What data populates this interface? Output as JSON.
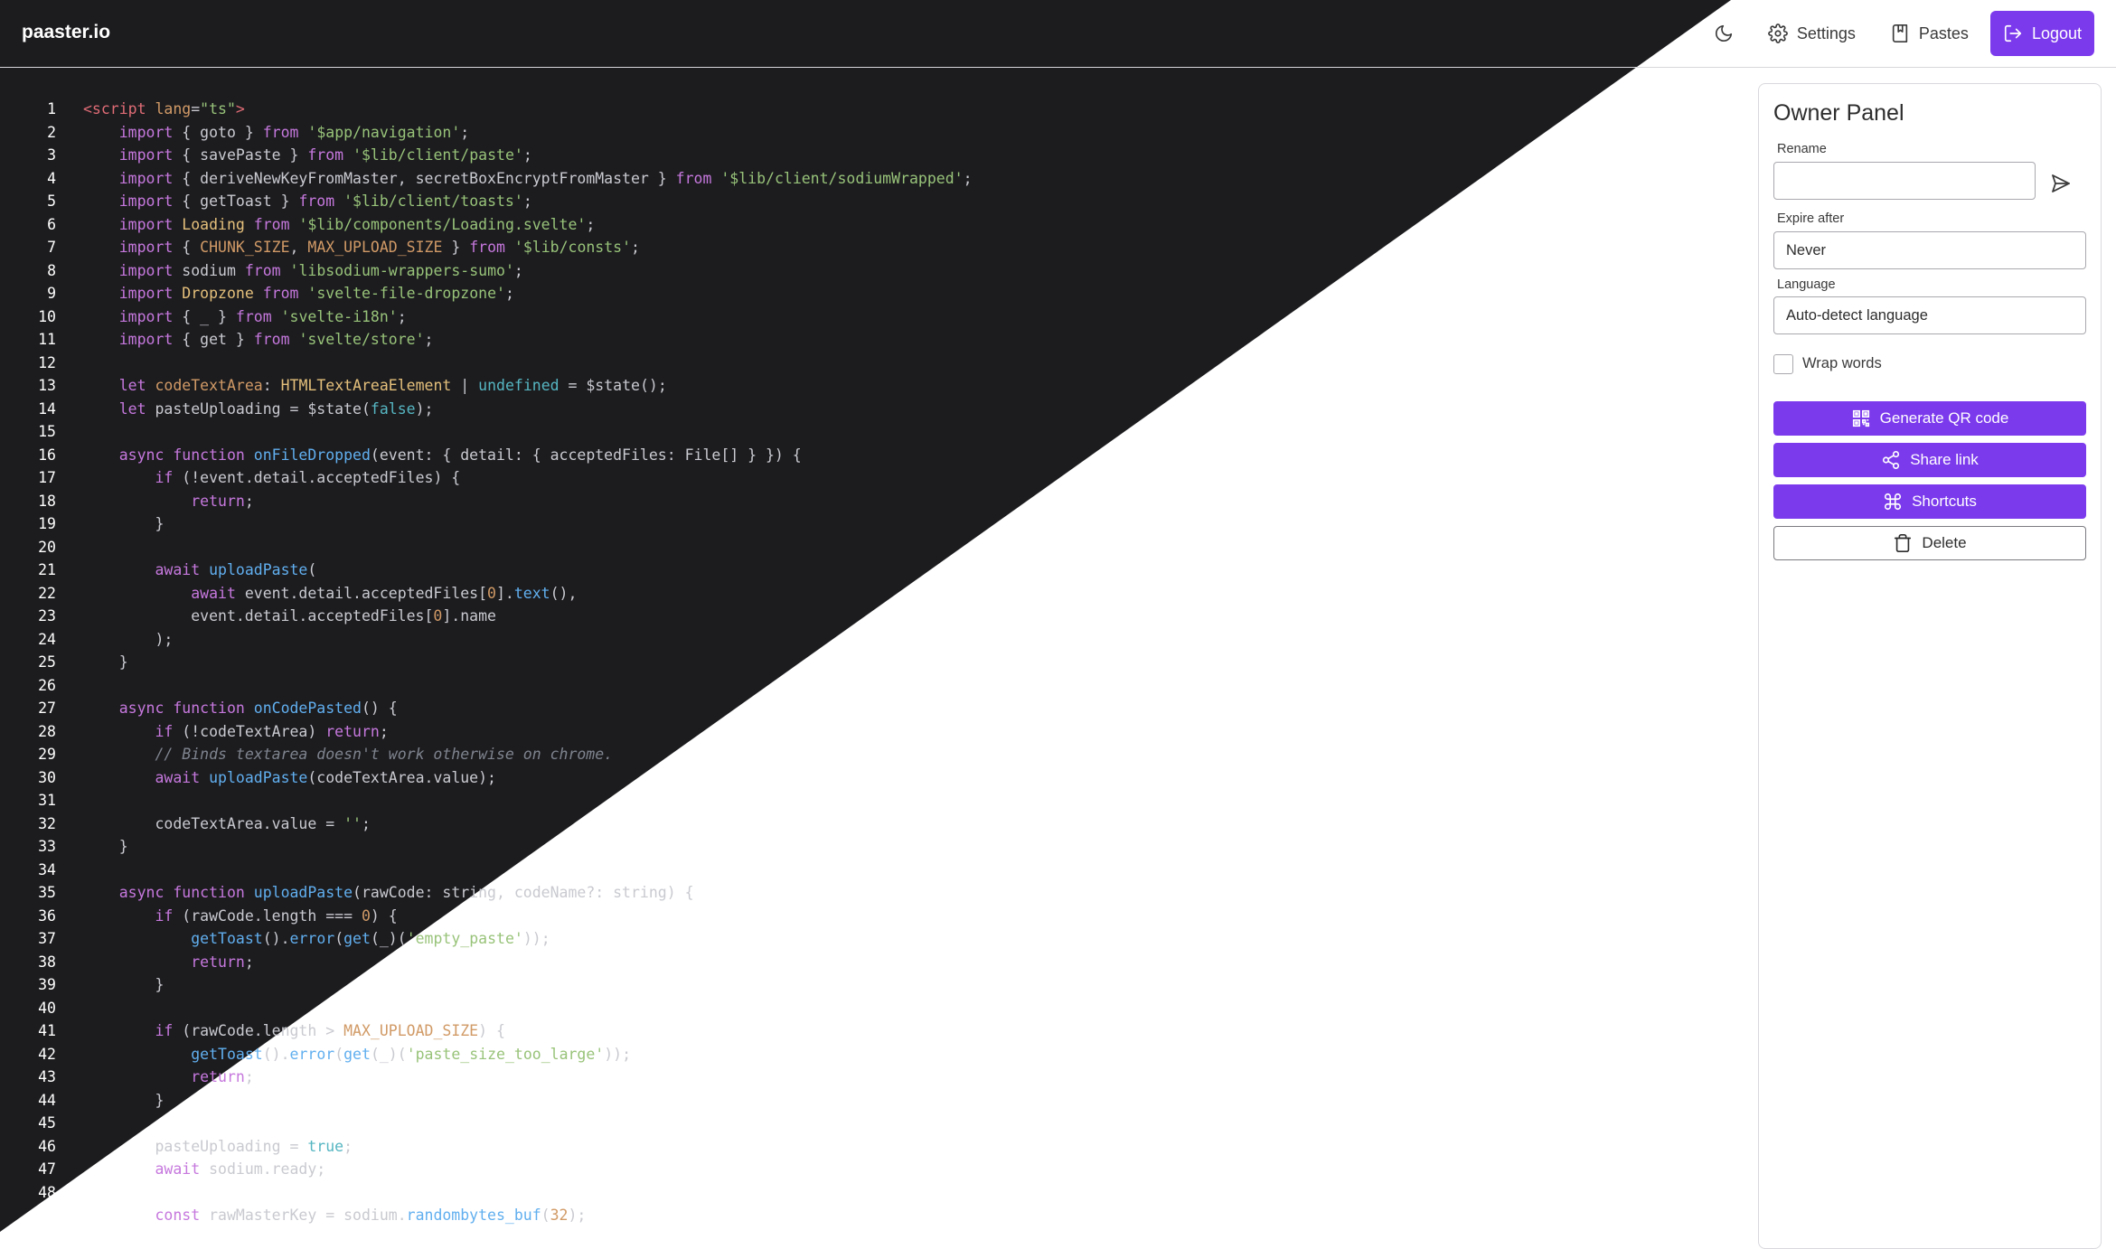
{
  "brand": "paaster.io",
  "nav": {
    "theme_icon": "moon-icon",
    "settings_label": "Settings",
    "pastes_label": "Pastes",
    "logout_label": "Logout"
  },
  "owner_panel": {
    "title": "Owner Panel",
    "rename_label": "Rename",
    "rename_value": "",
    "expire_label": "Expire after",
    "expire_value": "Never",
    "language_label": "Language",
    "language_value": "Auto-detect language",
    "wrap_label": "Wrap words",
    "wrap_checked": false,
    "qr_label": "Generate QR code",
    "share_label": "Share link",
    "shortcuts_label": "Shortcuts",
    "delete_label": "Delete"
  },
  "code_lines": [
    [
      [
        "tag",
        "<script"
      ],
      [
        "attr",
        " lang"
      ],
      [
        "txt",
        "="
      ],
      [
        "str",
        "\"ts\""
      ],
      [
        "tag",
        ">"
      ]
    ],
    [
      [
        "txt",
        "    "
      ],
      [
        "kw",
        "import"
      ],
      [
        "txt",
        " { goto } "
      ],
      [
        "kw",
        "from"
      ],
      [
        "txt",
        " "
      ],
      [
        "str",
        "'$app/navigation'"
      ],
      [
        "txt",
        ";"
      ]
    ],
    [
      [
        "txt",
        "    "
      ],
      [
        "kw",
        "import"
      ],
      [
        "txt",
        " { savePaste } "
      ],
      [
        "kw",
        "from"
      ],
      [
        "txt",
        " "
      ],
      [
        "str",
        "'$lib/client/paste'"
      ],
      [
        "txt",
        ";"
      ]
    ],
    [
      [
        "txt",
        "    "
      ],
      [
        "kw",
        "import"
      ],
      [
        "txt",
        " { deriveNewKeyFromMaster, secretBoxEncryptFromMaster } "
      ],
      [
        "kw",
        "from"
      ],
      [
        "txt",
        " "
      ],
      [
        "str",
        "'$lib/client/sodiumWrapped'"
      ],
      [
        "txt",
        ";"
      ]
    ],
    [
      [
        "txt",
        "    "
      ],
      [
        "kw",
        "import"
      ],
      [
        "txt",
        " { getToast } "
      ],
      [
        "kw",
        "from"
      ],
      [
        "txt",
        " "
      ],
      [
        "str",
        "'$lib/client/toasts'"
      ],
      [
        "txt",
        ";"
      ]
    ],
    [
      [
        "txt",
        "    "
      ],
      [
        "kw",
        "import"
      ],
      [
        "txt",
        " "
      ],
      [
        "cls",
        "Loading"
      ],
      [
        "txt",
        " "
      ],
      [
        "kw",
        "from"
      ],
      [
        "txt",
        " "
      ],
      [
        "str",
        "'$lib/components/Loading.svelte'"
      ],
      [
        "txt",
        ";"
      ]
    ],
    [
      [
        "txt",
        "    "
      ],
      [
        "kw",
        "import"
      ],
      [
        "txt",
        " { "
      ],
      [
        "const",
        "CHUNK_SIZE"
      ],
      [
        "txt",
        ", "
      ],
      [
        "const",
        "MAX_UPLOAD_SIZE"
      ],
      [
        "txt",
        " } "
      ],
      [
        "kw",
        "from"
      ],
      [
        "txt",
        " "
      ],
      [
        "str",
        "'$lib/consts'"
      ],
      [
        "txt",
        ";"
      ]
    ],
    [
      [
        "txt",
        "    "
      ],
      [
        "kw",
        "import"
      ],
      [
        "txt",
        " sodium "
      ],
      [
        "kw",
        "from"
      ],
      [
        "txt",
        " "
      ],
      [
        "str",
        "'libsodium-wrappers-sumo'"
      ],
      [
        "txt",
        ";"
      ]
    ],
    [
      [
        "txt",
        "    "
      ],
      [
        "kw",
        "import"
      ],
      [
        "txt",
        " "
      ],
      [
        "cls",
        "Dropzone"
      ],
      [
        "txt",
        " "
      ],
      [
        "kw",
        "from"
      ],
      [
        "txt",
        " "
      ],
      [
        "str",
        "'svelte-file-dropzone'"
      ],
      [
        "txt",
        ";"
      ]
    ],
    [
      [
        "txt",
        "    "
      ],
      [
        "kw",
        "import"
      ],
      [
        "txt",
        " { _ } "
      ],
      [
        "kw",
        "from"
      ],
      [
        "txt",
        " "
      ],
      [
        "str",
        "'svelte-i18n'"
      ],
      [
        "txt",
        ";"
      ]
    ],
    [
      [
        "txt",
        "    "
      ],
      [
        "kw",
        "import"
      ],
      [
        "txt",
        " { get } "
      ],
      [
        "kw",
        "from"
      ],
      [
        "txt",
        " "
      ],
      [
        "str",
        "'svelte/store'"
      ],
      [
        "txt",
        ";"
      ]
    ],
    [
      [
        "txt",
        ""
      ]
    ],
    [
      [
        "txt",
        "    "
      ],
      [
        "kw",
        "let"
      ],
      [
        "txt",
        " "
      ],
      [
        "const",
        "codeTextArea"
      ],
      [
        "txt",
        ": "
      ],
      [
        "cls",
        "HTMLTextAreaElement"
      ],
      [
        "txt",
        " | "
      ],
      [
        "typ",
        "undefined"
      ],
      [
        "txt",
        " = $state();"
      ]
    ],
    [
      [
        "txt",
        "    "
      ],
      [
        "kw",
        "let"
      ],
      [
        "txt",
        " pasteUploading = $state("
      ],
      [
        "bool",
        "false"
      ],
      [
        "txt",
        ");"
      ]
    ],
    [
      [
        "txt",
        ""
      ]
    ],
    [
      [
        "txt",
        "    "
      ],
      [
        "kw",
        "async function"
      ],
      [
        "txt",
        " "
      ],
      [
        "fn",
        "onFileDropped"
      ],
      [
        "txt",
        "(event: { detail: { acceptedFiles: File[] } }) {"
      ]
    ],
    [
      [
        "txt",
        "        "
      ],
      [
        "kw",
        "if"
      ],
      [
        "txt",
        " (!event.detail.acceptedFiles) {"
      ]
    ],
    [
      [
        "txt",
        "            "
      ],
      [
        "kw",
        "return"
      ],
      [
        "txt",
        ";"
      ]
    ],
    [
      [
        "txt",
        "        }"
      ]
    ],
    [
      [
        "txt",
        ""
      ]
    ],
    [
      [
        "txt",
        "        "
      ],
      [
        "kw",
        "await"
      ],
      [
        "txt",
        " "
      ],
      [
        "fn",
        "uploadPaste"
      ],
      [
        "txt",
        "("
      ]
    ],
    [
      [
        "txt",
        "            "
      ],
      [
        "kw",
        "await"
      ],
      [
        "txt",
        " event.detail.acceptedFiles["
      ],
      [
        "num",
        "0"
      ],
      [
        "txt",
        "]."
      ],
      [
        "fn",
        "text"
      ],
      [
        "txt",
        "(),"
      ]
    ],
    [
      [
        "txt",
        "            event.detail.acceptedFiles["
      ],
      [
        "num",
        "0"
      ],
      [
        "txt",
        "].name"
      ]
    ],
    [
      [
        "txt",
        "        );"
      ]
    ],
    [
      [
        "txt",
        "    }"
      ]
    ],
    [
      [
        "txt",
        ""
      ]
    ],
    [
      [
        "txt",
        "    "
      ],
      [
        "kw",
        "async function"
      ],
      [
        "txt",
        " "
      ],
      [
        "fn",
        "onCodePasted"
      ],
      [
        "txt",
        "() {"
      ]
    ],
    [
      [
        "txt",
        "        "
      ],
      [
        "kw",
        "if"
      ],
      [
        "txt",
        " (!codeTextArea) "
      ],
      [
        "kw",
        "return"
      ],
      [
        "txt",
        ";"
      ]
    ],
    [
      [
        "txt",
        "        "
      ],
      [
        "cmt",
        "// Binds textarea doesn't work otherwise on chrome."
      ]
    ],
    [
      [
        "txt",
        "        "
      ],
      [
        "kw",
        "await"
      ],
      [
        "txt",
        " "
      ],
      [
        "fn",
        "uploadPaste"
      ],
      [
        "txt",
        "(codeTextArea.value);"
      ]
    ],
    [
      [
        "txt",
        ""
      ]
    ],
    [
      [
        "txt",
        "        codeTextArea.value = "
      ],
      [
        "str",
        "''"
      ],
      [
        "txt",
        ";"
      ]
    ],
    [
      [
        "txt",
        "    }"
      ]
    ],
    [
      [
        "txt",
        ""
      ]
    ],
    [
      [
        "txt",
        "    "
      ],
      [
        "kw",
        "async function"
      ],
      [
        "txt",
        " "
      ],
      [
        "fn",
        "uploadPaste"
      ],
      [
        "txt",
        "(rawCode: string, codeName?: string) {"
      ]
    ],
    [
      [
        "txt",
        "        "
      ],
      [
        "kw",
        "if"
      ],
      [
        "txt",
        " (rawCode.length === "
      ],
      [
        "num",
        "0"
      ],
      [
        "txt",
        ") {"
      ]
    ],
    [
      [
        "txt",
        "            "
      ],
      [
        "fn",
        "getToast"
      ],
      [
        "txt",
        "()."
      ],
      [
        "fn",
        "error"
      ],
      [
        "txt",
        "("
      ],
      [
        "fn",
        "get"
      ],
      [
        "txt",
        "(_)("
      ],
      [
        "str",
        "'empty_paste'"
      ],
      [
        "txt",
        "));"
      ]
    ],
    [
      [
        "txt",
        "            "
      ],
      [
        "kw",
        "return"
      ],
      [
        "txt",
        ";"
      ]
    ],
    [
      [
        "txt",
        "        }"
      ]
    ],
    [
      [
        "txt",
        ""
      ]
    ],
    [
      [
        "txt",
        "        "
      ],
      [
        "kw",
        "if"
      ],
      [
        "txt",
        " (rawCode.length > "
      ],
      [
        "const",
        "MAX_UPLOAD_SIZE"
      ],
      [
        "txt",
        ") {"
      ]
    ],
    [
      [
        "txt",
        "            "
      ],
      [
        "fn",
        "getToast"
      ],
      [
        "txt",
        "()."
      ],
      [
        "fn",
        "error"
      ],
      [
        "txt",
        "("
      ],
      [
        "fn",
        "get"
      ],
      [
        "txt",
        "(_)("
      ],
      [
        "str",
        "'paste_size_too_large'"
      ],
      [
        "txt",
        "));"
      ]
    ],
    [
      [
        "txt",
        "            "
      ],
      [
        "kw",
        "return"
      ],
      [
        "txt",
        ";"
      ]
    ],
    [
      [
        "txt",
        "        }"
      ]
    ],
    [
      [
        "txt",
        ""
      ]
    ],
    [
      [
        "txt",
        "        pasteUploading = "
      ],
      [
        "bool",
        "true"
      ],
      [
        "txt",
        ";"
      ]
    ],
    [
      [
        "txt",
        "        "
      ],
      [
        "kw",
        "await"
      ],
      [
        "txt",
        " sodium.ready;"
      ]
    ],
    [
      [
        "txt",
        ""
      ]
    ],
    [
      [
        "txt",
        "        "
      ],
      [
        "kw",
        "const"
      ],
      [
        "txt",
        " rawMasterKey = sodium."
      ],
      [
        "fn",
        "randombytes_buf"
      ],
      [
        "txt",
        "("
      ],
      [
        "num",
        "32"
      ],
      [
        "txt",
        ");"
      ]
    ]
  ]
}
